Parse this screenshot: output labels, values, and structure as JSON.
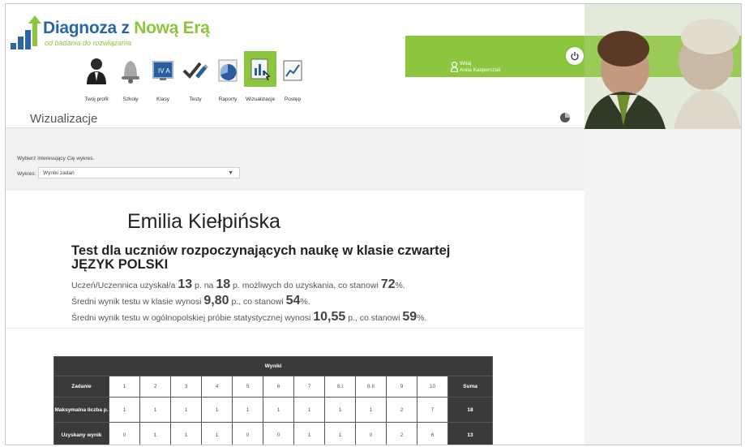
{
  "brand": {
    "title_part1": "Diagnoza z ",
    "title_part2": "Nową Erą",
    "subtitle": "od badania do rozwiązania"
  },
  "nav": [
    {
      "label": "Twój profil",
      "icon": "user-profile-icon"
    },
    {
      "label": "Szkoły",
      "icon": "school-bell-icon"
    },
    {
      "label": "Klasy",
      "icon": "class-board-icon"
    },
    {
      "label": "Testy",
      "icon": "test-check-icon"
    },
    {
      "label": "Raporty",
      "icon": "report-chart-icon"
    },
    {
      "label": "Wizualizacje",
      "icon": "visualization-icon"
    },
    {
      "label": "Postęp",
      "icon": "progress-chart-icon"
    }
  ],
  "active_nav": "Wizualizacje",
  "user": {
    "greeting": "Witaj",
    "name": "Anita Kasperczak"
  },
  "page_title": "Wizualizacje",
  "chart_select": {
    "hint": "Wybierz interesujący Cię wykres.",
    "label": "Wykres:",
    "value": "Wyniki zadań"
  },
  "student": {
    "name": "Emilia Kiełpińska",
    "test_line1": "Test dla uczniów rozpoczynających naukę w klasie czwartej",
    "test_line2": "JĘZYK POLSKI",
    "line1": {
      "a": "Uczeń/Uczennica uzyskał/a ",
      "score": "13",
      "b": " p. na ",
      "max": "18",
      "c": " p. możliwych do uzyskania, co stanowi ",
      "pct": "72",
      "d": "%."
    },
    "line2": {
      "a": "Średni wynik testu w klasie wynosi ",
      "score": "9,80",
      "b": " p., co stanowi ",
      "pct": "54",
      "c": "%."
    },
    "line3": {
      "a": "Średni wynik testu w ogólnopolskiej próbie statystycznej wynosi ",
      "score": "10,55",
      "b": " p., co stanowi ",
      "pct": "59",
      "c": "%."
    }
  },
  "results_table": {
    "title": "Wyniki",
    "row_labels": [
      "Zadanie",
      "Maksymalna liczba p.",
      "Uzyskany wynik"
    ],
    "tasks": [
      "1",
      "2",
      "3",
      "4",
      "5",
      "6",
      "7",
      "8.I",
      "8.II",
      "9",
      "10"
    ],
    "max_points": [
      "1",
      "1",
      "1",
      "1",
      "1",
      "1",
      "1",
      "1",
      "1",
      "2",
      "7"
    ],
    "obtained": [
      "0",
      "1",
      "1",
      "1",
      "0",
      "0",
      "1",
      "1",
      "0",
      "2",
      "6"
    ],
    "sum_label": "Suma",
    "sum_max": "18",
    "sum_obtained": "13"
  },
  "colors": {
    "accent_green": "#8cc63e",
    "brand_blue": "#2a66a6",
    "table_dark": "#3a3a3a"
  }
}
